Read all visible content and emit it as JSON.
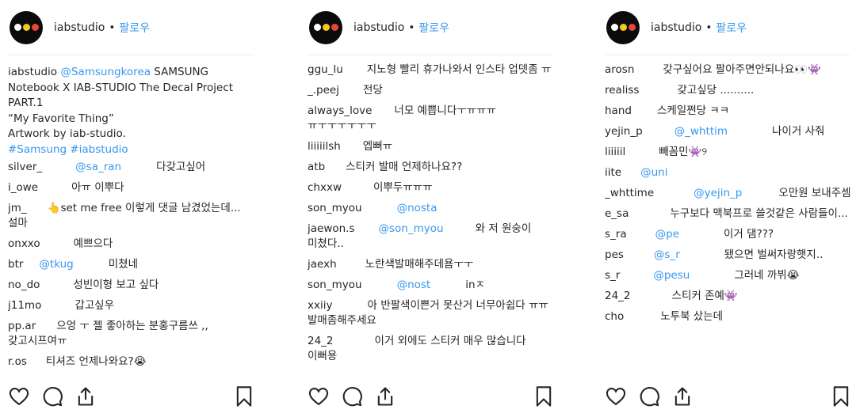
{
  "account": {
    "username": "iabstudio",
    "separator": "•",
    "follow_label": "팔로우"
  },
  "panel1": {
    "caption": {
      "user": "iabstudio",
      "mention": "@Samsungkorea",
      "line1_rest": " SAMSUNG Notebook X IAB-STUDIO The Decal Project PART.1",
      "line2": "“My Favorite Thing”",
      "line3": "Artwork by iab-studio.",
      "tags": "#Samsung #iabstudio"
    },
    "comments": [
      {
        "user": "silver_",
        "mention": "@sa_ran",
        "text": "다갖고싶어"
      },
      {
        "user": "i_owe",
        "text": "아ㅠ 이뿌다"
      },
      {
        "user": "jm_",
        "text": "👆set me free 이렇게 댓글 남겼었는데...설마"
      },
      {
        "user": "onxxo",
        "text": "예쁘으다"
      },
      {
        "user": "btr",
        "mention": "@tkug",
        "text": "미쳤네"
      },
      {
        "user": "no_do",
        "text": "성빈이형 보고 싶다"
      },
      {
        "user": "j11mo",
        "text": "갑고싶우"
      },
      {
        "user": "pp.ar",
        "text": "으엉 ㅜ 젤 좋아하는 분홍구름쓰 ,, 갖고시프여ㅠ"
      },
      {
        "user": "r.os",
        "text": "티셔즈 언제나와요?😭"
      }
    ]
  },
  "panel2": {
    "comments": [
      {
        "user": "ggu_lu",
        "text": "지노형 빨리 휴가나와서 인스타 업뎃좀 ㅠ"
      },
      {
        "user": "_.peej",
        "text": "전당"
      },
      {
        "user": "always_love",
        "text": "너모 예쁩니다ㅜㅠㅠㅠ ㅠㅜㅜㅜㅜㅜㅜ"
      },
      {
        "user": "liiiiilsh",
        "text": "엡뻐ㅠ"
      },
      {
        "user": "atb",
        "text": "스티커 발매 언제하나요??"
      },
      {
        "user": "chxxw",
        "text": "이뿌두ㅠㅠㅠ"
      },
      {
        "user": "son_myou",
        "mention": "@nosta",
        "text": ""
      },
      {
        "user": "jaewon.s",
        "mention": "@son_myou",
        "text": "와 저 원숭이 미쳤다.."
      },
      {
        "user": "jaexh",
        "text": "노란색발매해주데욤ㅜㅜ"
      },
      {
        "user": "son_myou",
        "mention": "@nost",
        "text": "inㅈ"
      },
      {
        "user": "xxiiy",
        "text": "아 반팔색이쁜거 못산거 너무아쉽다 ㅠㅠ 발매좀해주세요"
      },
      {
        "user": "24_2",
        "text": "이거 외에도 스티커 매우 많습니다 이뻐용"
      }
    ]
  },
  "panel3": {
    "comments": [
      {
        "user": "arosn",
        "text": "갖구싶어요 팔아주면안되나요👀👾"
      },
      {
        "user": "realiss",
        "text": "갖고싶당 .........."
      },
      {
        "user": "hand",
        "text": "스케일쩐당 ㅋㅋ"
      },
      {
        "user": "yejin_p",
        "mention": "@_whttim",
        "text": "나이거 사줘"
      },
      {
        "user": "liiiiil",
        "text": "빼꼼민👾୨"
      },
      {
        "user": "iite",
        "mention": "@uni",
        "text": ""
      },
      {
        "user": "_whttime",
        "mention": "@yejin_p",
        "text": "오만원 보내주셈"
      },
      {
        "user": "e_sa",
        "text": "누구보다 맥북프로 쓸것같은 사람들이..."
      },
      {
        "user": "s_ra",
        "mention": "@pe",
        "text": "이거 댐???"
      },
      {
        "user": "pes",
        "mention": "@s_r",
        "text": "됐으면 벌써자랑햇지.."
      },
      {
        "user": "s_r",
        "mention": "@pesu",
        "text": "그러네 까뷔😭"
      },
      {
        "user": "24_2",
        "text": "스티커 존예👾"
      },
      {
        "user": "cho",
        "text": "노투북 샀는데"
      }
    ]
  },
  "icons": [
    "heart-icon",
    "comment-icon",
    "share-icon",
    "bookmark-icon"
  ]
}
